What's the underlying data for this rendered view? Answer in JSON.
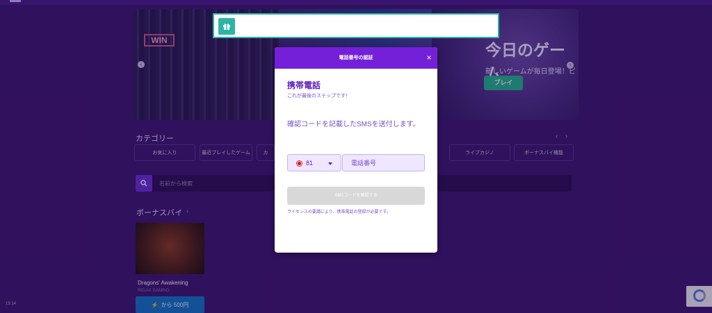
{
  "banner": {
    "win_sign": "WIN",
    "title": "今日のゲーム",
    "subtitle": "新しいゲームが毎日登場！ピクれ",
    "play_label": "プレイ"
  },
  "categories": {
    "title": "カテゴリー",
    "items": [
      "お気に入り",
      "最近プレイしたゲーム",
      "カ",
      "ライブカジノ",
      "ボーナスバイ機能"
    ]
  },
  "search": {
    "placeholder": "名前から検索"
  },
  "bonus_section": {
    "title": "ボーナスバイ",
    "game": {
      "name": "Dragons' Awakening",
      "provider": "RELAX GAMING",
      "price_label": "から 500円"
    }
  },
  "clock": "15:14",
  "modal": {
    "title": "電話番号の認証",
    "close": "×",
    "heading": "携帯電話",
    "subheading": "これが最後のステップです！",
    "description": "確認コードを記載したSMSを送付します。",
    "country_code": "81",
    "phone_placeholder": "電話番号",
    "submit_label": "SMSコードを確認する",
    "note": "ライセンスの要請により、携帯電話の登録が必要です。"
  },
  "colors": {
    "background": "#3b1670",
    "accent": "#7420d8",
    "teal": "#2bb5a5",
    "price_button": "#0e79c8"
  }
}
